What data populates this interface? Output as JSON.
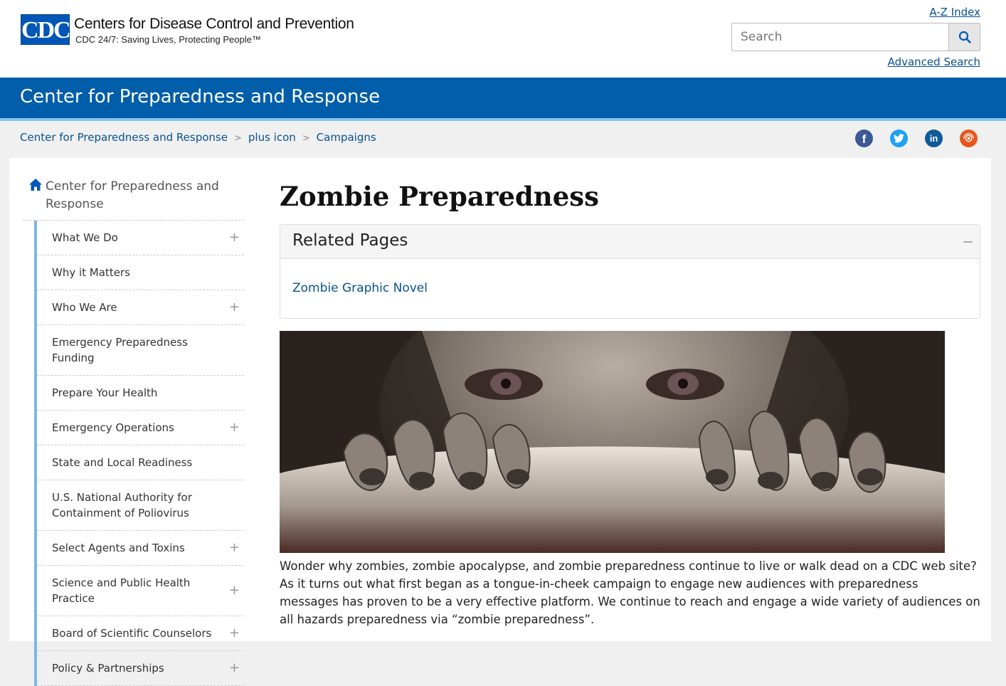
{
  "header": {
    "logo_text": "CDC",
    "org_name": "Centers for Disease Control and Prevention",
    "tagline": "CDC 24/7: Saving Lives, Protecting People™",
    "az_index": "A-Z Index",
    "search_placeholder": "Search",
    "advanced_search": "Advanced Search"
  },
  "site_bar": {
    "title": "Center for Preparedness and Response"
  },
  "breadcrumb": {
    "items": [
      "Center for Preparedness and Response",
      "plus icon",
      "Campaigns"
    ],
    "separator": ">"
  },
  "social": [
    {
      "name": "facebook",
      "glyph": "f",
      "color": "#3b5998"
    },
    {
      "name": "twitter",
      "glyph": "t",
      "color": "#1da1f2"
    },
    {
      "name": "linkedin",
      "glyph": "in",
      "color": "#0e5a99"
    },
    {
      "name": "syndicate",
      "glyph": "",
      "color": "#e8571c"
    }
  ],
  "nav": {
    "home_label": "Center for Preparedness and Response",
    "items": [
      {
        "label": "What We Do",
        "expandable": true
      },
      {
        "label": "Why it Matters",
        "expandable": false
      },
      {
        "label": "Who We Are",
        "expandable": true
      },
      {
        "label": "Emergency Preparedness Funding",
        "expandable": false
      },
      {
        "label": "Prepare Your Health",
        "expandable": false
      },
      {
        "label": "Emergency Operations",
        "expandable": true
      },
      {
        "label": "State and Local Readiness",
        "expandable": false
      },
      {
        "label": "U.S. National Authority for Containment of Poliovirus",
        "expandable": false
      },
      {
        "label": "Select Agents and Toxins",
        "expandable": true
      },
      {
        "label": "Science and Public Health Practice",
        "expandable": true
      },
      {
        "label": "Board of Scientific Counselors",
        "expandable": true
      },
      {
        "label": "Policy & Partnerships",
        "expandable": true
      }
    ]
  },
  "content": {
    "title": "Zombie Preparedness",
    "related_title": "Related Pages",
    "related_link": "Zombie Graphic Novel",
    "intro": "Wonder why zombies, zombie apocalypse, and zombie preparedness continue to live or walk dead on a CDC web site? As it turns out what first began as a tongue-in-cheek campaign to engage new audiences with preparedness messages has proven to be a very effective platform. We continue to reach and engage a wide variety of audiences on all hazards preparedness via “zombie preparedness”."
  },
  "colors": {
    "brand_blue": "#005eaa",
    "link": "#075290",
    "nav_accent": "#7ab8e6"
  }
}
